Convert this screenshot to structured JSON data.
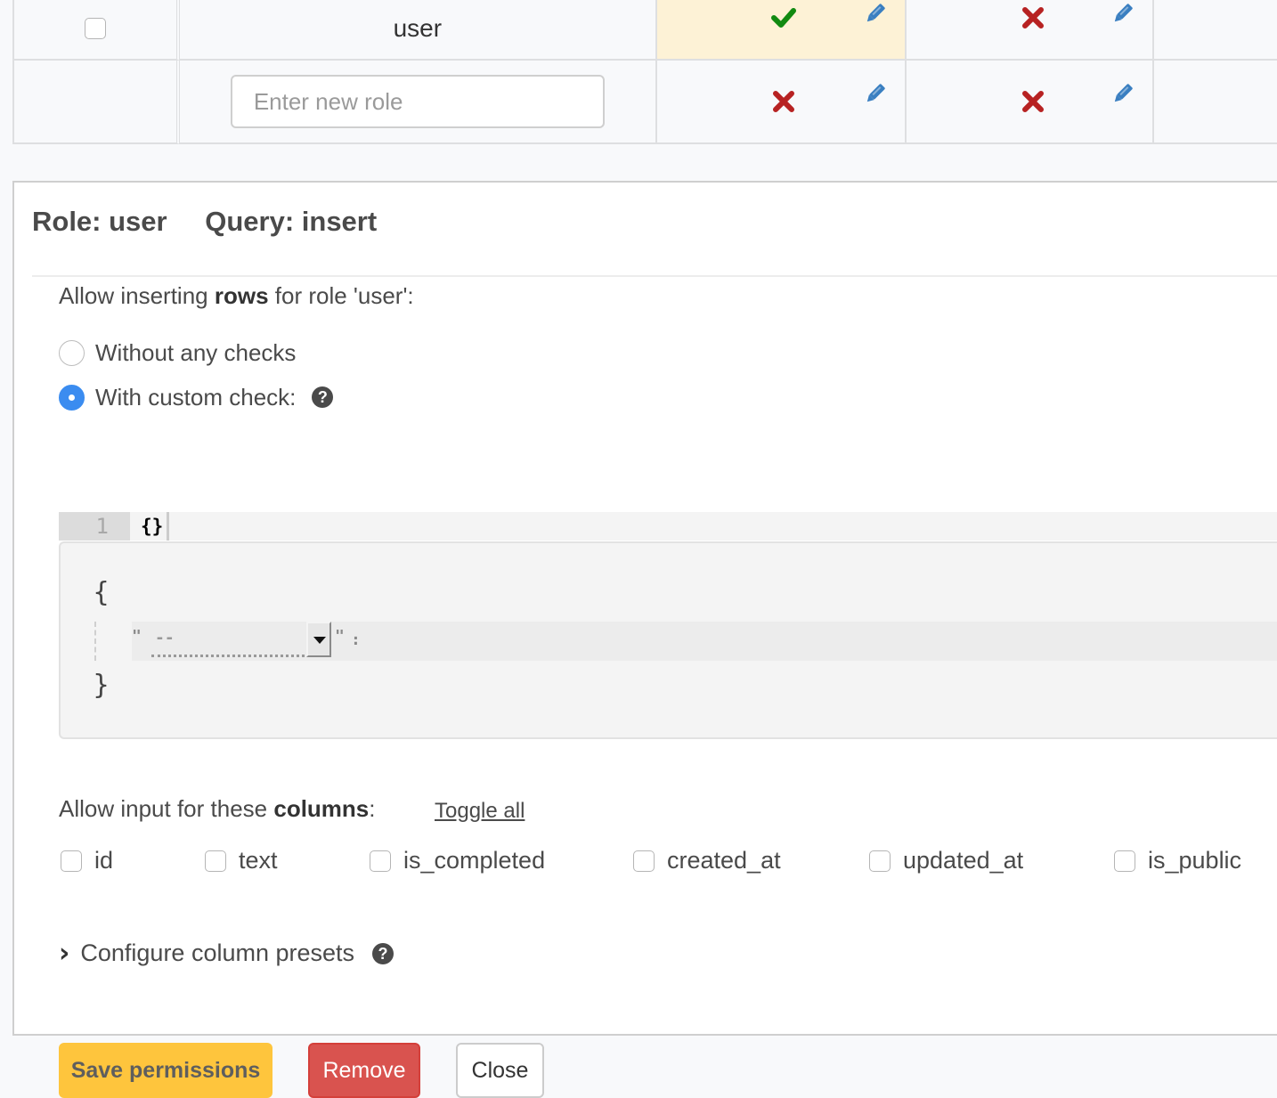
{
  "table": {
    "rows": [
      {
        "role": "user",
        "permissions": [
          {
            "status": "allowed",
            "status_icon": "check-icon",
            "edit_icon": "pencil-icon",
            "active": true
          },
          {
            "status": "denied",
            "status_icon": "cross-icon",
            "edit_icon": "pencil-icon",
            "active": false
          }
        ]
      },
      {
        "role_input_placeholder": "Enter new role",
        "role_input_value": "",
        "permissions": [
          {
            "status": "denied",
            "status_icon": "cross-icon",
            "edit_icon": "pencil-icon",
            "active": false
          },
          {
            "status": "denied",
            "status_icon": "cross-icon",
            "edit_icon": "pencil-icon",
            "active": false
          }
        ]
      }
    ]
  },
  "panel": {
    "role_label": "Role: user",
    "query_label": "Query: insert",
    "rows_section": {
      "prefix": "Allow inserting ",
      "bold": "rows",
      "suffix": " for role 'user':"
    },
    "radio_options": [
      {
        "label": "Without any checks",
        "checked": false
      },
      {
        "label": "With custom check:",
        "checked": true,
        "help_icon": "?"
      }
    ],
    "editor": {
      "line_number": "1",
      "code": "{}",
      "open_brace": "{",
      "close_brace": "}",
      "quote_open": "\"",
      "quote_close": "\"",
      "colon": ":",
      "key_select_value": "--"
    },
    "columns_section": {
      "prefix": "Allow input for these ",
      "bold": "columns",
      "suffix": ":",
      "toggle_all": "Toggle all",
      "columns": [
        {
          "name": "id",
          "checked": false
        },
        {
          "name": "text",
          "checked": false
        },
        {
          "name": "is_completed",
          "checked": false
        },
        {
          "name": "created_at",
          "checked": false
        },
        {
          "name": "updated_at",
          "checked": false
        },
        {
          "name": "is_public",
          "checked": false
        }
      ]
    },
    "presets_label": "Configure column presets",
    "help_glyph": "?",
    "buttons": {
      "save": "Save permissions",
      "remove": "Remove",
      "close": "Close"
    }
  },
  "colors": {
    "allowed": "#118a11",
    "denied": "#b72222",
    "edit": "#3a7fc1",
    "active_cell": "#fdf2d6",
    "save_button": "#fec53d",
    "remove_button": "#d9534f",
    "radio_checked": "#3b8cf0"
  }
}
